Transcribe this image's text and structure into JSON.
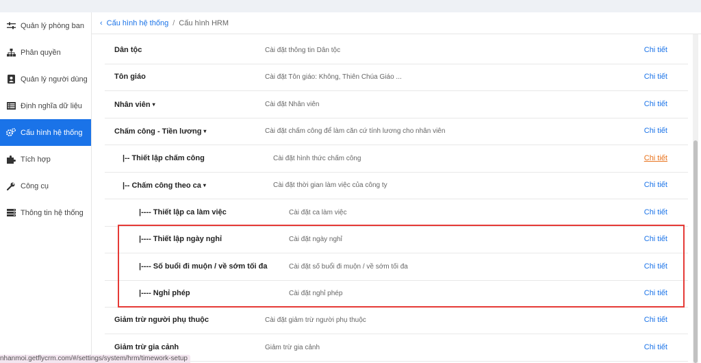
{
  "sidebar": {
    "items": [
      {
        "label": "Quản lý phòng ban",
        "icon": "sliders-icon"
      },
      {
        "label": "Phân quyền",
        "icon": "sitemap-icon"
      },
      {
        "label": "Quản lý người dùng",
        "icon": "user-card-icon"
      },
      {
        "label": "Định nghĩa dữ liệu",
        "icon": "list-icon"
      },
      {
        "label": "Cấu hình hệ thống",
        "icon": "gears-icon",
        "active": true
      },
      {
        "label": "Tích hợp",
        "icon": "puzzle-icon"
      },
      {
        "label": "Công cụ",
        "icon": "wrench-icon"
      },
      {
        "label": "Thông tin hệ thống",
        "icon": "server-icon"
      }
    ]
  },
  "breadcrumb": {
    "back_icon": "‹",
    "parent": "Cấu hình hệ thống",
    "separator": "/",
    "current": "Cấu hình HRM"
  },
  "rows": [
    {
      "name": "Dân tộc",
      "desc": "Cài đặt thông tin Dân tộc",
      "action": "Chi tiết"
    },
    {
      "name": "Tôn giáo",
      "desc": "Cài đặt Tôn giáo: Không, Thiên Chúa Giáo ...",
      "action": "Chi tiết"
    },
    {
      "name": "Nhân viên",
      "desc": "Cài đặt Nhân viên",
      "action": "Chi tiết",
      "caret": "▾"
    },
    {
      "name": "Chấm công - Tiền lương",
      "desc": "Cài đặt chấm công để làm căn cứ tính lương cho nhân viên",
      "action": "Chi tiết",
      "caret": "▾"
    },
    {
      "name": "|-- Thiết lập chấm công",
      "desc": "Cài đặt hình thức chấm công",
      "action": "Chi tiết"
    },
    {
      "name": "|-- Chấm công theo ca",
      "desc": "Cài đặt thời gian làm việc của công ty",
      "action": "Chi tiết",
      "caret": "▾"
    },
    {
      "name": "|---- Thiết lập ca làm việc",
      "desc": "Cài đặt ca làm việc",
      "action": "Chi tiết"
    },
    {
      "name": "|---- Thiết lập ngày nghỉ",
      "desc": "Cài đặt ngày nghỉ",
      "action": "Chi tiết"
    },
    {
      "name": "|---- Số buổi đi muộn / về sớm tối đa",
      "desc": "Cài đặt số buổi đi muộn / về sớm tối đa",
      "action": "Chi tiết"
    },
    {
      "name": "|---- Nghỉ phép",
      "desc": "Cài đặt nghỉ phép",
      "action": "Chi tiết"
    },
    {
      "name": "Giảm trừ người phụ thuộc",
      "desc": "Cài đặt giảm trừ người phụ thuộc",
      "action": "Chi tiết"
    },
    {
      "name": "Giảm trừ gia cảnh",
      "desc": "Giảm trừ gia cảnh",
      "action": "Chi tiết"
    }
  ],
  "status_bar": {
    "url": "nhanmoi.getflycrm.com/#/settings/system/hrm/timework-setup"
  },
  "colors": {
    "accent": "#1a73e8",
    "hover_link": "#e8711a",
    "highlight_border": "#e53935"
  }
}
